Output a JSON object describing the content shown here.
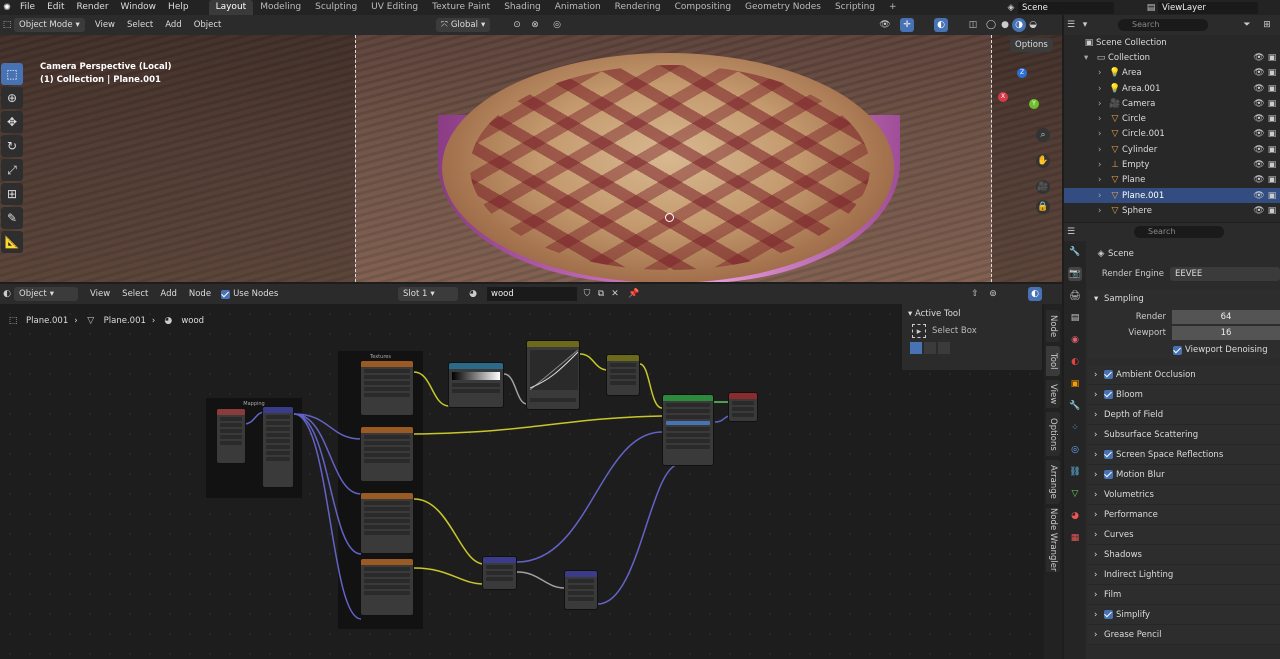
{
  "topbar": {
    "menus": [
      "File",
      "Edit",
      "Render",
      "Window",
      "Help"
    ],
    "workspaces": [
      "Layout",
      "Modeling",
      "Sculpting",
      "UV Editing",
      "Texture Paint",
      "Shading",
      "Animation",
      "Rendering",
      "Compositing",
      "Geometry Nodes",
      "Scripting"
    ],
    "active_workspace": "Layout",
    "add_tab": "+",
    "scene": "Scene",
    "view_layer": "ViewLayer"
  },
  "viewport": {
    "mode": "Object Mode",
    "menus": [
      "View",
      "Select",
      "Add",
      "Object"
    ],
    "transform": "Global",
    "options": "Options",
    "overlay_line1": "Camera Perspective (Local)",
    "overlay_line2": "(1) Collection | Plane.001",
    "gizmo": {
      "x": "X",
      "y": "Y",
      "z": "Z"
    }
  },
  "node_editor": {
    "mode": "Object",
    "menus": [
      "View",
      "Select",
      "Add",
      "Node"
    ],
    "use_nodes": "Use Nodes",
    "slot": "Slot 1",
    "material": "wood",
    "breadcrumb": [
      "Plane.001",
      "Plane.001",
      "wood"
    ],
    "frame_label": "Textures",
    "mapping_frame": "Mapping",
    "side_tabs": [
      "Node",
      "Tool",
      "View",
      "Options",
      "Arrange",
      "Node Wrangler"
    ],
    "active_tool": {
      "title": "Active Tool",
      "tool": "Select Box"
    }
  },
  "outliner": {
    "search_placeholder": "Search",
    "root": "Scene Collection",
    "collection": "Collection",
    "items": [
      {
        "name": "Area",
        "selected": false
      },
      {
        "name": "Area.001",
        "selected": false
      },
      {
        "name": "Camera",
        "selected": false
      },
      {
        "name": "Circle",
        "selected": false
      },
      {
        "name": "Circle.001",
        "selected": false
      },
      {
        "name": "Cylinder",
        "selected": false
      },
      {
        "name": "Empty",
        "selected": false
      },
      {
        "name": "Plane",
        "selected": false
      },
      {
        "name": "Plane.001",
        "selected": true
      },
      {
        "name": "Sphere",
        "selected": false
      }
    ]
  },
  "properties": {
    "search_placeholder": "Search",
    "scene_label": "Scene",
    "render_engine_label": "Render Engine",
    "render_engine": "EEVEE",
    "sampling": "Sampling",
    "render_label": "Render",
    "render_value": "64",
    "viewport_label": "Viewport",
    "viewport_value": "16",
    "viewport_denoising": "Viewport Denoising",
    "panels": [
      {
        "label": "Ambient Occlusion",
        "checkbox": true
      },
      {
        "label": "Bloom",
        "checkbox": true
      },
      {
        "label": "Depth of Field",
        "checkbox": false
      },
      {
        "label": "Subsurface Scattering",
        "checkbox": false
      },
      {
        "label": "Screen Space Reflections",
        "checkbox": true
      },
      {
        "label": "Motion Blur",
        "checkbox": true
      },
      {
        "label": "Volumetrics",
        "checkbox": false
      },
      {
        "label": "Performance",
        "checkbox": false
      },
      {
        "label": "Curves",
        "checkbox": false
      },
      {
        "label": "Shadows",
        "checkbox": false
      },
      {
        "label": "Indirect Lighting",
        "checkbox": false
      },
      {
        "label": "Film",
        "checkbox": false
      },
      {
        "label": "Simplify",
        "checkbox": true
      },
      {
        "label": "Grease Pencil",
        "checkbox": false
      }
    ]
  },
  "colors": {
    "accent": "#4772b3",
    "selection": "#334d80",
    "bg": "#1d1d1d",
    "panel": "#2b2b2b"
  }
}
